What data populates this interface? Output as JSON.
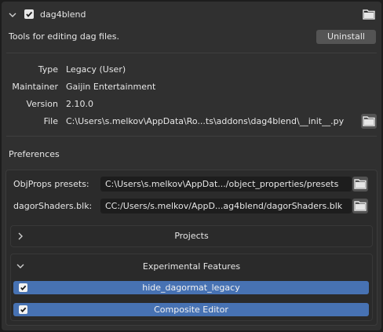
{
  "addon": {
    "name": "dag4blend",
    "enabled": true,
    "description": "Tools for editing dag files.",
    "uninstall_label": "Uninstall"
  },
  "info": {
    "type_label": "Type",
    "type_value": "Legacy (User)",
    "maintainer_label": "Maintainer",
    "maintainer_value": "Gaijin Entertainment",
    "version_label": "Version",
    "version_value": "2.10.0",
    "file_label": "File",
    "file_value": "C:\\Users\\s.melkov\\AppData\\Ro...ts\\addons\\dag4blend\\__init__.py"
  },
  "preferences": {
    "title": "Preferences",
    "objprops_label": "ObjProps presets:",
    "objprops_value": "C:\\Users\\s.melkov\\AppDat.../object_properties/presets",
    "shaders_label": "dagorShaders.blk:",
    "shaders_value": "CC:/Users/s.melkov/AppD...ag4blend/dagorShaders.blk",
    "projects_label": "Projects",
    "experimental_label": "Experimental Features",
    "toggles": [
      {
        "label": "hide_dagormat_legacy",
        "checked": true
      },
      {
        "label": "Composite Editor",
        "checked": true
      }
    ]
  },
  "colors": {
    "accent": "#4772b3",
    "background": "#303030",
    "field": "#1d1d1d",
    "button": "#545454"
  },
  "icons": [
    "chevron-down-icon",
    "checkbox-icon",
    "folder-icon",
    "chevron-right-icon"
  ]
}
